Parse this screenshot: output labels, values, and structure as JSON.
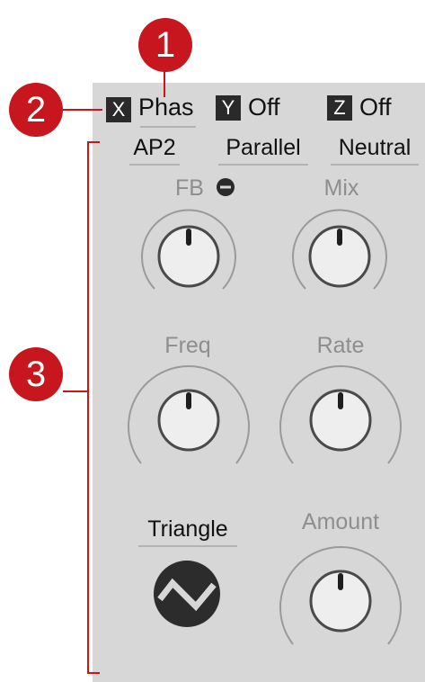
{
  "callouts": {
    "c1": "1",
    "c2": "2",
    "c3": "3"
  },
  "mod_dest": {
    "x": {
      "axis": "X",
      "value": "Phas"
    },
    "y": {
      "axis": "Y",
      "value": "Off"
    },
    "z": {
      "axis": "Z",
      "value": "Off"
    }
  },
  "modes": {
    "algo": "AP2",
    "routing": "Parallel",
    "character": "Neutral"
  },
  "knobs": {
    "fb": {
      "label": "FB"
    },
    "mix": {
      "label": "Mix"
    },
    "freq": {
      "label": "Freq"
    },
    "rate": {
      "label": "Rate"
    },
    "amount": {
      "label": "Amount"
    }
  },
  "lfo": {
    "shape": "Triangle"
  },
  "colors": {
    "accent": "#c7161d",
    "panel": "#d7d7d7",
    "text": "#111111",
    "dim_label": "#8e8e8e"
  },
  "icons": {
    "fb_invert": "minus-circle-icon",
    "wave": "triangle-wave-icon"
  }
}
